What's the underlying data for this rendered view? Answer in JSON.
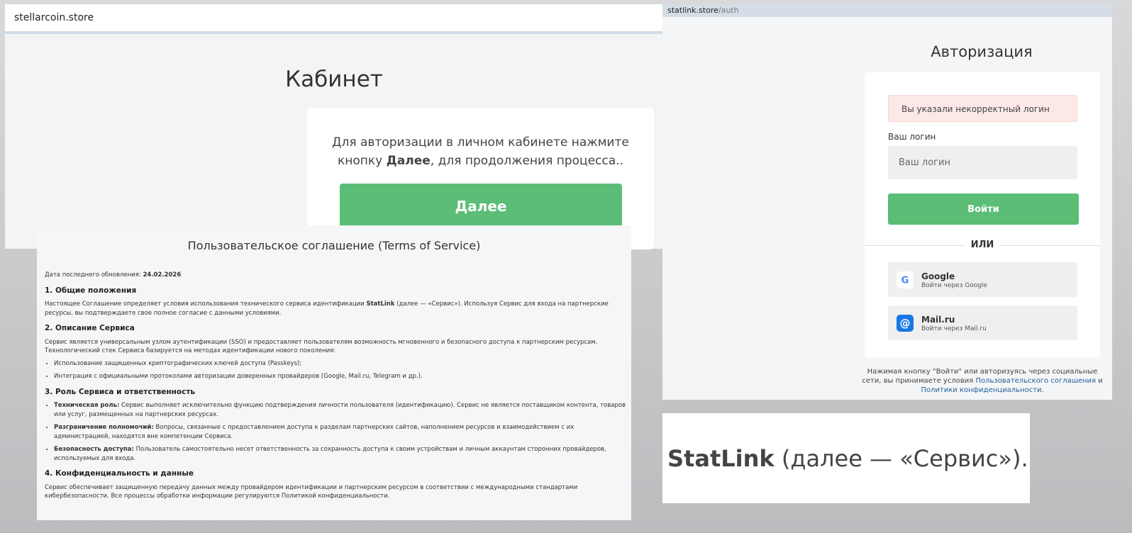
{
  "cabinet": {
    "url": "stellarcoin.store",
    "title": "Кабинет",
    "text_before": "Для авторизации в личном кабинете нажмите кнопку ",
    "text_bold": "Далее",
    "text_after": ", для продолжения процесса..",
    "button_label": "Далее",
    "button_color": "#5bbd76"
  },
  "auth": {
    "url_domain": "statlink.store",
    "url_path": "/auth",
    "title": "Авторизация",
    "error": "Вы указали некорректный логин",
    "login_label": "Ваш логин",
    "login_placeholder": "Ваш логин",
    "login_value": "",
    "submit_label": "Войти",
    "or_label": "ИЛИ",
    "google": {
      "name": "Google",
      "sub": "Войти через Google",
      "icon": "G",
      "icon_name": "google-logo-icon"
    },
    "mailru": {
      "name": "Mail.ru",
      "sub": "Войти через Mail.ru",
      "icon": "@",
      "icon_name": "mailru-logo-icon"
    },
    "consent_1": "Нажимая кнопку \"Войти\" или авторизуясь через социальные сети, вы принимаете условия ",
    "consent_link_1": "Пользовательского соглашения",
    "consent_2": " и ",
    "consent_link_2": "Политики конфиденциальности",
    "consent_3": ".",
    "error_bg": "#fde8e8",
    "accent": "#5bbd76",
    "link_color": "#1f5f9d"
  },
  "terms": {
    "title": "Пользовательское соглашение (Terms of Service)",
    "updated_label": "Дата последнего обновления: ",
    "updated_date": "24.02.2026",
    "s1_title": "1. Общие положения",
    "s1_p_before": "Настоящее Соглашение определяет условия использования технического сервиса идентификации ",
    "s1_p_bold": "StatLink",
    "s1_p_after": " (далее — «Сервис»). Используя Сервис для входа на партнерские ресурсы, вы подтверждаете свое полное согласие с данными условиями.",
    "s2_title": "2. Описание Сервиса",
    "s2_p": "Сервис является универсальным узлом аутентификации (SSO) и предоставляет пользователям возможность мгновенного и безопасного доступа к партнерским ресурсам. Технологический стек Сервиса базируется на методах идентификации нового поколения:",
    "s2_li1": "Использование защищенных криптографических ключей доступа (Passkeys);",
    "s2_li2": "Интеграция с официальными протоколами авторизации доверенных провайдеров (Google, Mail.ru, Telegram и др.).",
    "s3_title": "3. Роль Сервиса и ответственность",
    "s3_li1_b": "Техническая роль:",
    "s3_li1": " Сервис выполняет исключительно функцию подтверждения личности пользователя (идентификацию). Сервис не является поставщиком контента, товаров или услуг, размещенных на партнерских ресурсах.",
    "s3_li2_b": "Разграничение полномочий:",
    "s3_li2": " Вопросы, связанные с предоставлением доступа к разделам партнерских сайтов, наполнением ресурсов и взаимодействием с их администрацией, находятся вне компетенции Сервиса.",
    "s3_li3_b": "Безопасность доступа:",
    "s3_li3": " Пользователь самостоятельно несет ответственность за сохранность доступа к своим устройствам и личным аккаунтам сторонних провайдеров, используемых для входа.",
    "s4_title": "4. Конфиденциальность и данные",
    "s4_p": "Сервис обеспечивает защищенную передачу данных между провайдером идентификации и партнерским ресурсом в соответствии с международными стандартами кибербезопасности. Все процессы обработки информации регулируются Политикой конфиденциальности."
  },
  "zoom": {
    "brand": "StatLink",
    "rest": " (далее — «Сервис»)."
  }
}
